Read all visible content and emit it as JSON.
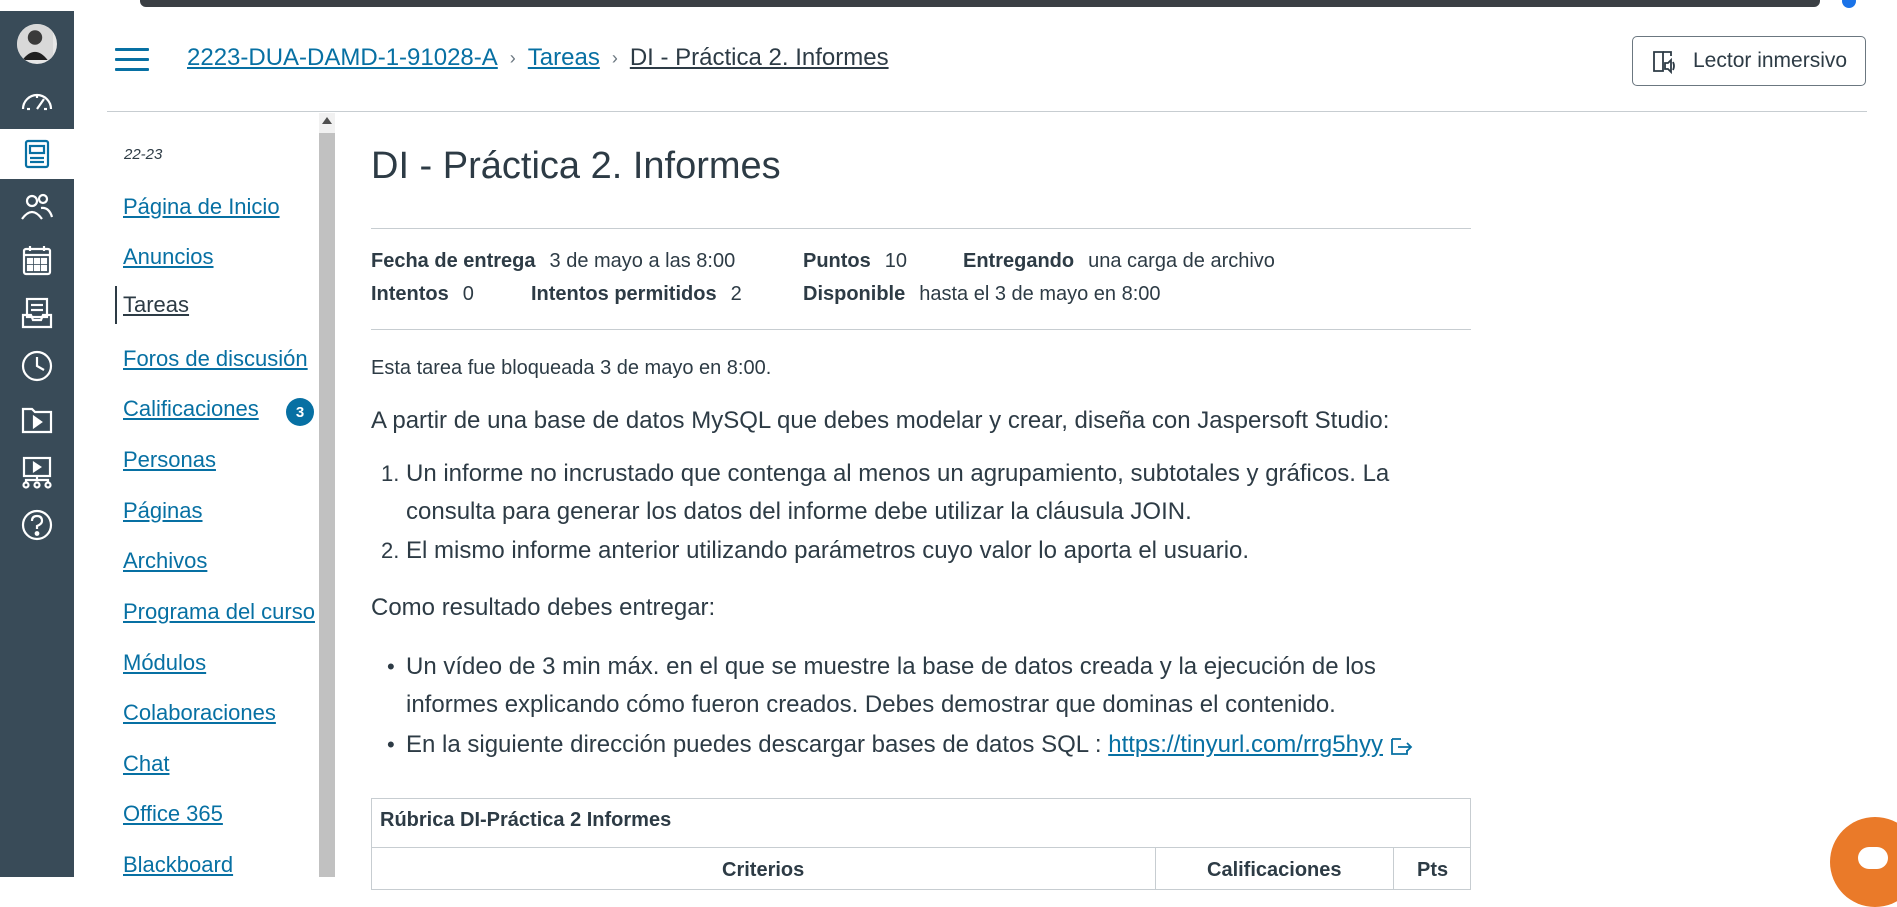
{
  "breadcrumbs": {
    "course": "2223-DUA-DAMD-1-91028-A",
    "section": "Tareas",
    "current": "DI - Práctica 2. Informes"
  },
  "immersive_reader": {
    "label": "Lector inmersivo"
  },
  "global_nav": {
    "items": [
      {
        "icon": "avatar"
      },
      {
        "icon": "dashboard-icon"
      },
      {
        "icon": "courses-icon",
        "active": true
      },
      {
        "icon": "groups-icon"
      },
      {
        "icon": "calendar-icon"
      },
      {
        "icon": "inbox-icon"
      },
      {
        "icon": "history-icon"
      },
      {
        "icon": "files-icon"
      },
      {
        "icon": "studio-icon"
      },
      {
        "icon": "help-icon"
      }
    ]
  },
  "course_nav": {
    "term": "22-23",
    "items": [
      {
        "label": "Página de Inicio"
      },
      {
        "label": "Anuncios"
      },
      {
        "label": "Tareas",
        "active": true
      },
      {
        "label": "Foros de discusión"
      },
      {
        "label": "Calificaciones",
        "badge": "3"
      },
      {
        "label": "Personas"
      },
      {
        "label": "Páginas"
      },
      {
        "label": "Archivos"
      },
      {
        "label": "Programa del curso"
      },
      {
        "label": "Módulos"
      },
      {
        "label": "Colaboraciones"
      },
      {
        "label": "Chat"
      },
      {
        "label": "Office 365"
      },
      {
        "label": "Blackboard"
      }
    ]
  },
  "assignment": {
    "title": "DI - Práctica 2. Informes",
    "details": {
      "due_label": "Fecha de entrega",
      "due_value": "3 de mayo a las 8:00",
      "points_label": "Puntos",
      "points_value": "10",
      "submitting_label": "Entregando",
      "submitting_value": "una carga de archivo",
      "attempts_label": "Intentos",
      "attempts_value": "0",
      "allowed_label": "Intentos permitidos",
      "allowed_value": "2",
      "available_label": "Disponible",
      "available_value": "hasta el 3 de mayo en 8:00"
    },
    "lock_note": "Esta tarea fue bloqueada 3 de mayo en 8:00.",
    "intro": "A partir de una base de datos MySQL que debes modelar y crear, diseña con Jaspersoft Studio:",
    "ordered": {
      "item1_line1": "Un informe no incrustado que contenga al menos un agrupamiento,  subtotales y gráficos.  La",
      "item1_line2": "consulta para generar los datos del informe debe utilizar la cláusula JOIN.",
      "item2": "El mismo informe anterior utilizando parámetros cuyo valor lo aporta el usuario."
    },
    "result_heading": "Como resultado debes entregar:",
    "bullets": {
      "item1_line1": "Un vídeo de 3 min máx. en el que se muestre la base de datos creada y  la ejecución de los",
      "item1_line2": "informes explicando cómo fueron creados. Debes demostrar que dominas el contenido.",
      "item2_text": "En la siguiente dirección puedes descargar bases de datos SQL : ",
      "item2_link": "https://tinyurl.com/rrg5hyy"
    },
    "rubric": {
      "title": "Rúbrica DI-Práctica 2 Informes",
      "columns": [
        "Criterios",
        "Calificaciones",
        "Pts"
      ]
    }
  },
  "colors": {
    "nav_bg": "#394b58",
    "link": "#0770a3",
    "text": "#2d3b45",
    "chat_bubble": "#ea7a29"
  }
}
